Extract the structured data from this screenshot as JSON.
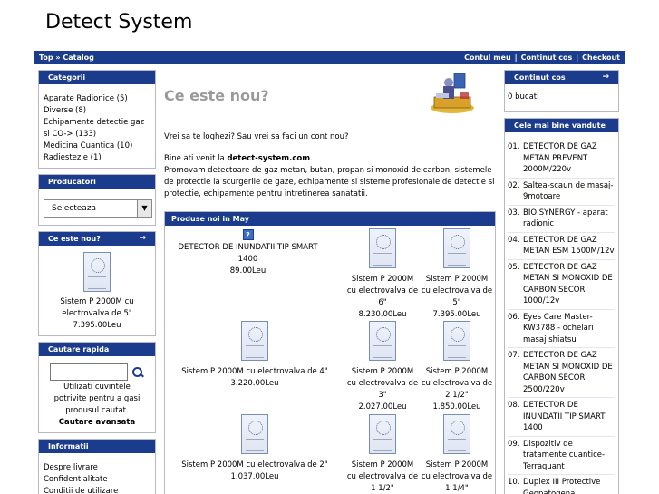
{
  "site": {
    "title": "Detect System"
  },
  "topbar": {
    "breadcrumb": [
      "Top",
      "»",
      "Catalog"
    ],
    "links": [
      "Contul meu",
      "Continut cos",
      "Checkout"
    ]
  },
  "categories": {
    "title": "Categorii",
    "items": [
      "Aparate Radionice (5)",
      "Diverse (8)",
      "Echipamente detectie gaz si CO-> (133)",
      "Medicina Cuantica (10)",
      "Radiestezie (1)"
    ]
  },
  "manufacturers": {
    "title": "Producatori",
    "select_value": "Selecteaza"
  },
  "whats_new_side": {
    "title": "Ce este nou?",
    "product": "Sistem P 2000M cu electrovalva de 5\"",
    "price": "7.395.00Leu"
  },
  "quick_search": {
    "title": "Cautare rapida",
    "hint": "Utilizati cuvintele potrivite pentru a gasi produsul cautat.",
    "advanced_link": "Cautare avansata"
  },
  "information": {
    "title": "Informatii",
    "items": [
      "Despre livrare",
      "Confidentialitate",
      "Conditii de utilizare"
    ]
  },
  "main": {
    "heading": "Ce este nou?",
    "intro_q1": "Vrei sa te ",
    "intro_link1": "loghezi",
    "intro_q2": "? Sau vrei sa ",
    "intro_link2": "faci un cont nou",
    "intro_q3": "?",
    "welcome_prefix": "Bine ati venit la ",
    "welcome_site": "detect-system.com",
    "welcome_suffix": ".",
    "description": "Promovam detectoare de gaz metan, butan, propan si monoxid de carbon, sistemele de protectie la scurgerile de gaze, echipamente si sisteme profesionale de detectie si protectie, echipamente pentru intretinerea sanatatii."
  },
  "new_products": {
    "title": "Produse noi in May",
    "items": [
      {
        "name": "DETECTOR DE INUNDATII TIP SMART 1400",
        "price": "89.00Leu"
      },
      {
        "name": "Sistem P 2000M cu electrovalva de 6\"",
        "price": "8.230.00Leu"
      },
      {
        "name": "Sistem P 2000M cu electrovalva de 5\"",
        "price": "7.395.00Leu"
      },
      {
        "name": "Sistem P 2000M cu electrovalva de 4\"",
        "price": "3.220.00Leu"
      },
      {
        "name": "Sistem P 2000M cu electrovalva de 3\"",
        "price": "2.027.00Leu"
      },
      {
        "name": "Sistem P 2000M cu electrovalva de 2 1/2\"",
        "price": "1.850.00Leu"
      },
      {
        "name": "Sistem P 2000M cu electrovalva de 2\"",
        "price": "1.037.00Leu"
      },
      {
        "name": "Sistem P 2000M cu electrovalva de 1 1/2\"",
        "price": ""
      },
      {
        "name": "Sistem P 2000M cu electrovalva de 1 1/4\"",
        "price": ""
      }
    ]
  },
  "cart": {
    "title": "Continut cos",
    "content": "0 bucati"
  },
  "bestsellers": {
    "title": "Cele mai bine vandute",
    "items": [
      {
        "n": "01.",
        "label": "DETECTOR DE GAZ METAN PREVENT 2000M/220v"
      },
      {
        "n": "02.",
        "label": "Saltea-scaun de masaj-9motoare"
      },
      {
        "n": "03.",
        "label": "BIO SYNERGY - aparat radionic"
      },
      {
        "n": "04.",
        "label": "DETECTOR DE GAZ METAN ESM 1500M/12v"
      },
      {
        "n": "05.",
        "label": "DETECTOR DE GAZ METAN SI MONOXID DE CARBON SECOR 1000/12v"
      },
      {
        "n": "06.",
        "label": "Eyes Care Master-KW3788 - ochelari masaj shiatsu"
      },
      {
        "n": "07.",
        "label": "DETECTOR DE GAZ METAN SI MONOXID DE CARBON SECOR 2500/220v"
      },
      {
        "n": "08.",
        "label": "DETECTOR DE INUNDATII TIP SMART 1400"
      },
      {
        "n": "09.",
        "label": "Dispozitiv de tratamente cuantice-Terraquant"
      },
      {
        "n": "10.",
        "label": "Duplex III Protective Geopatogena"
      }
    ]
  },
  "colors": {
    "header_bar": "#1b3c8c",
    "box_border": "#b6b7cb",
    "heading_gray": "#9a9a9a"
  },
  "icons": {
    "side_arrow": "→",
    "unknown_image": "?"
  }
}
